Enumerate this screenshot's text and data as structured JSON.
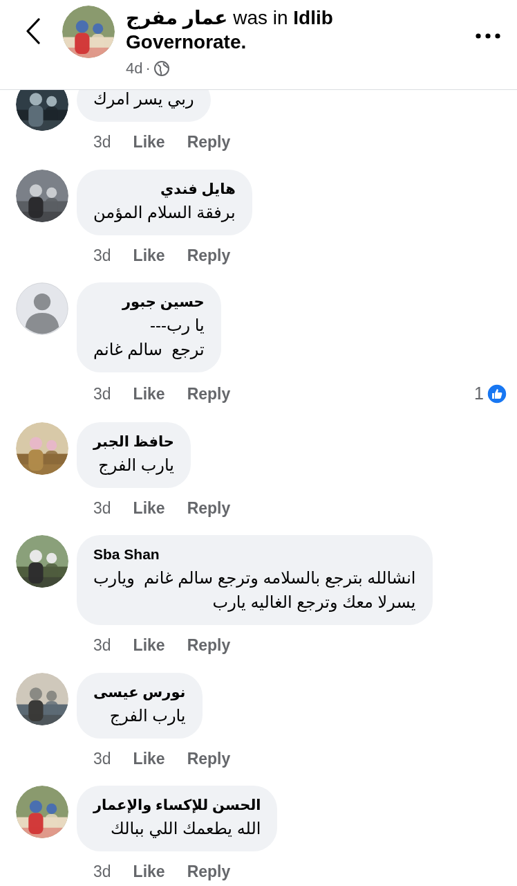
{
  "header": {
    "title": "**عمار مفرج** was in **Idlib Governorate.**",
    "time": "4d",
    "separator": "·",
    "avatar": {
      "kind": "picture"
    }
  },
  "comments": [
    {
      "avatar": {
        "kind": "picture"
      },
      "lines": [
        "ربي يسر امرك"
      ],
      "time": "3d",
      "like": "Like",
      "reply": "Reply"
    },
    {
      "avatar": {
        "kind": "picture"
      },
      "name": "هايل فندي",
      "lines": [
        "برفقة السلام المؤمن"
      ],
      "time": "3d",
      "like": "Like",
      "reply": "Reply"
    },
    {
      "avatar": {
        "kind": "default"
      },
      "name": "حسين جبور",
      "lines": [
        "يا رب---",
        "ترجع  سالم غانم"
      ],
      "time": "3d",
      "like": "Like",
      "reply": "Reply",
      "reactions": "1"
    },
    {
      "avatar": {
        "kind": "picture"
      },
      "name": "حافظ الجبر",
      "lines": [
        "يارب الفرج"
      ],
      "time": "3d",
      "like": "Like",
      "reply": "Reply"
    },
    {
      "avatar": {
        "kind": "picture"
      },
      "name": "Sba Shan",
      "lines": [
        "انشالله بترجع بالسلامه وترجع سالم غانم  ويارب",
        "يسرلا معك وترجع الغاليه يارب"
      ],
      "time": "3d",
      "like": "Like",
      "reply": "Reply"
    },
    {
      "avatar": {
        "kind": "picture"
      },
      "name": "نورس عيسى",
      "lines": [
        "يارب الفرج"
      ],
      "time": "3d",
      "like": "Like",
      "reply": "Reply"
    },
    {
      "avatar": {
        "kind": "picture"
      },
      "name": "الحسن للإكساء والإعمار",
      "lines": [
        "الله يطعمك اللي ببالك"
      ],
      "time": "3d",
      "like": "Like",
      "reply": "Reply"
    }
  ]
}
